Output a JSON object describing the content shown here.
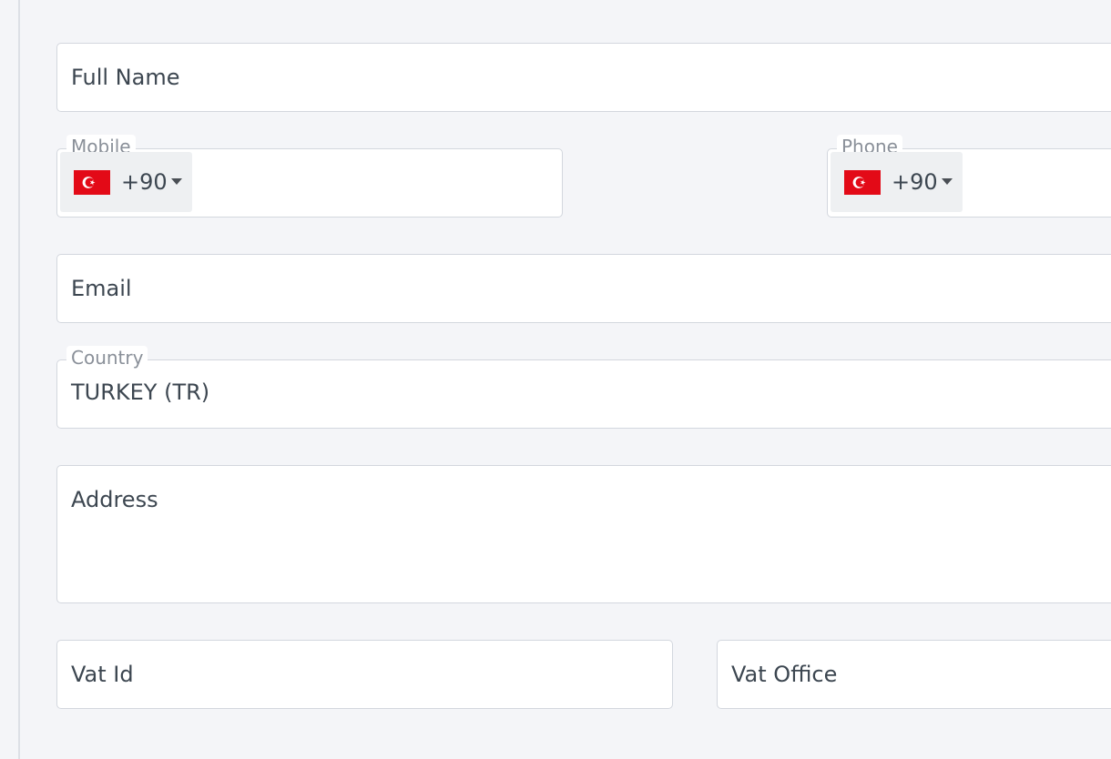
{
  "form": {
    "full_name": {
      "placeholder": "Full Name"
    },
    "mobile": {
      "label": "Mobile",
      "country_code": "+90",
      "flag_icon": "turkey-flag-icon",
      "value": ""
    },
    "phone": {
      "label": "Phone",
      "country_code": "+90",
      "flag_icon": "turkey-flag-icon",
      "value": ""
    },
    "email": {
      "placeholder": "Email"
    },
    "country": {
      "label": "Country",
      "value": "TURKEY (TR)"
    },
    "address": {
      "placeholder": "Address"
    },
    "vat_id": {
      "placeholder": "Vat Id"
    },
    "vat_office": {
      "placeholder": "Vat Office"
    }
  },
  "colors": {
    "background": "#f4f5f8",
    "field_border": "#d3d7de",
    "flag_red": "#e30a17"
  }
}
